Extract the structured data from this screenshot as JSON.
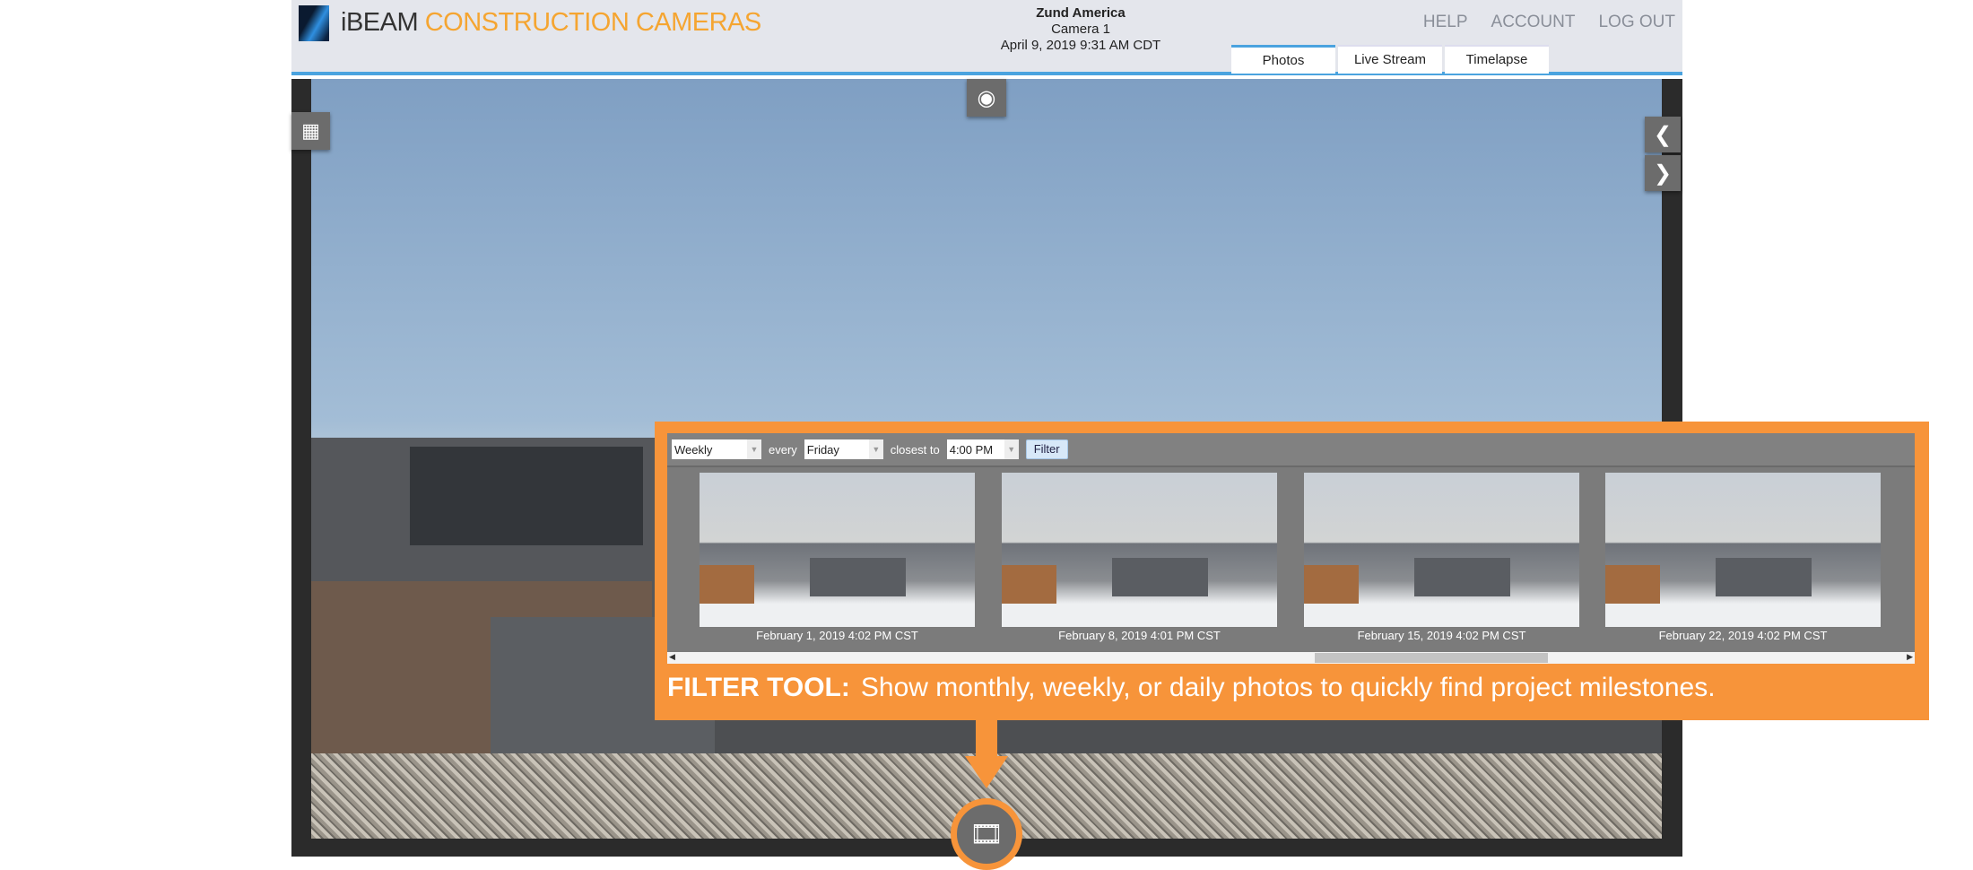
{
  "header": {
    "brand_primary": "iBEAM",
    "brand_secondary": "CONSTRUCTION CAMERAS",
    "project": "Zund America",
    "camera": "Camera 1",
    "datetime": "April 9, 2019 9:31 AM CDT",
    "nav": [
      "HELP",
      "ACCOUNT",
      "LOG OUT"
    ],
    "tabs": [
      {
        "label": "Photos",
        "active": true
      },
      {
        "label": "Live Stream"
      },
      {
        "label": "Timelapse"
      }
    ]
  },
  "controls": {
    "camera_icon": "camera-icon",
    "calendar_icon": "calendar-icon",
    "prev_icon": "chevron-left-icon",
    "next_icon": "chevron-right-icon",
    "film_icon": "film-icon"
  },
  "filter": {
    "frequency": "Weekly",
    "every_label": "every",
    "day": "Friday",
    "closest_label": "closest to",
    "time": "4:00 PM",
    "button": "Filter",
    "thumbnails": [
      "February 1, 2019 4:02 PM CST",
      "February 8, 2019 4:01 PM CST",
      "February 15, 2019 4:02 PM CST",
      "February 22, 2019 4:02 PM CST"
    ]
  },
  "callout": {
    "title": "FILTER TOOL:",
    "text": "Show monthly, weekly, or daily photos to quickly find project milestones."
  },
  "colors": {
    "accent": "#4aa3df",
    "brand_orange": "#f5a531",
    "callout": "#f7943a"
  }
}
